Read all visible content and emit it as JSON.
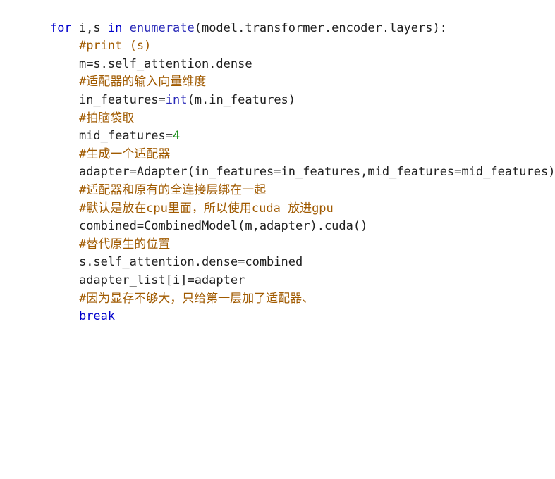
{
  "editor": {
    "lines": [
      {
        "tokens": [
          {
            "t": "for",
            "c": "kw"
          },
          {
            "t": " i,s ",
            "c": "plain"
          },
          {
            "t": "in",
            "c": "kw"
          },
          {
            "t": " ",
            "c": "plain"
          },
          {
            "t": "enumerate",
            "c": "bi"
          },
          {
            "t": "(model.transformer.encoder.layers):",
            "c": "plain"
          }
        ]
      },
      {
        "tokens": [
          {
            "t": "#print (s)",
            "c": "cm"
          }
        ]
      },
      {
        "tokens": [
          {
            "t": "m=s.self_attention.dense",
            "c": "plain"
          }
        ]
      },
      {
        "tokens": [
          {
            "t": "#适配器的输入向量维度",
            "c": "cm"
          }
        ]
      },
      {
        "tokens": [
          {
            "t": "in_features=",
            "c": "plain"
          },
          {
            "t": "int",
            "c": "bi"
          },
          {
            "t": "(m.in_features)",
            "c": "plain"
          }
        ]
      },
      {
        "tokens": [
          {
            "t": "#拍脑袋取",
            "c": "cm"
          }
        ]
      },
      {
        "tokens": [
          {
            "t": "mid_features=",
            "c": "plain"
          },
          {
            "t": "4",
            "c": "num"
          }
        ]
      },
      {
        "tokens": [
          {
            "t": "#生成一个适配器",
            "c": "cm"
          }
        ]
      },
      {
        "tokens": [
          {
            "t": "adapter=Adapter(in_features=in_features,mid_features=mid_features)",
            "c": "plain"
          }
        ]
      },
      {
        "tokens": [
          {
            "t": "#适配器和原有的全连接层绑在一起",
            "c": "cm"
          }
        ]
      },
      {
        "tokens": [
          {
            "t": "#默认是放在cpu里面，所以使用cuda 放进gpu",
            "c": "cm"
          }
        ]
      },
      {
        "tokens": [
          {
            "t": "combined=CombinedModel(m,adapter).cuda()",
            "c": "plain"
          }
        ]
      },
      {
        "tokens": [
          {
            "t": "#替代原生的位置",
            "c": "cm"
          }
        ]
      },
      {
        "tokens": [
          {
            "t": "s.self_attention.dense=combined",
            "c": "plain"
          }
        ]
      },
      {
        "tokens": [
          {
            "t": "adapter_list[i]=adapter",
            "c": "plain"
          }
        ]
      },
      {
        "tokens": [
          {
            "t": "#因为显存不够大，只给第一层加了适配器、",
            "c": "cm"
          }
        ]
      },
      {
        "tokens": [
          {
            "t": "break",
            "c": "kw"
          }
        ]
      }
    ]
  },
  "colors": {
    "keyword": "#0000cc",
    "builtin": "#2a2ab8",
    "number": "#128a12",
    "comment": "#a05a00",
    "text": "#1f1f1f",
    "background": "#ffffff"
  }
}
